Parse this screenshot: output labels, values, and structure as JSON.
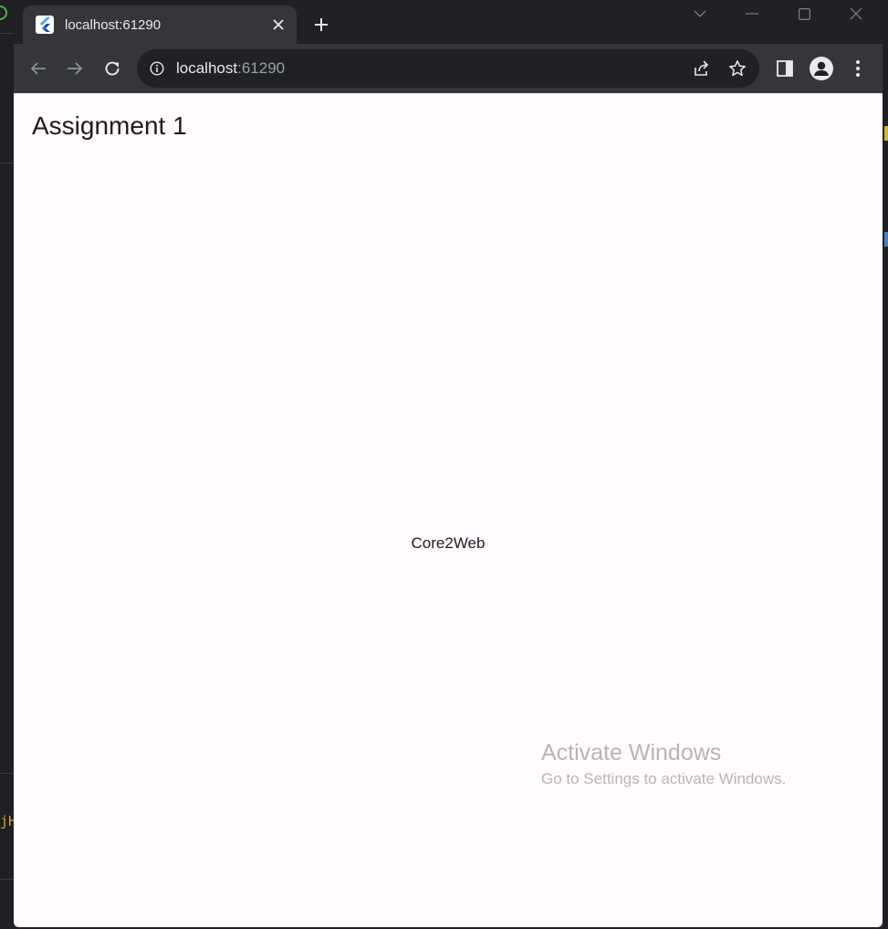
{
  "browser": {
    "tab": {
      "title": "localhost:61290",
      "favicon": "flutter-icon",
      "close_icon": "close-icon"
    },
    "new_tab_icon": "plus-icon",
    "window_controls": [
      "chevron-down-icon",
      "minimize-icon",
      "maximize-icon",
      "close-icon"
    ],
    "toolbar": {
      "back_icon": "arrow-left-icon",
      "forward_icon": "arrow-right-icon",
      "reload_icon": "reload-icon",
      "address": {
        "host": "localhost",
        "port": ":61290",
        "info_icon": "info-icon"
      },
      "share_icon": "share-icon",
      "bookmark_icon": "star-icon",
      "side_panel_icon": "side-panel-icon",
      "profile_icon": "avatar-icon",
      "menu_icon": "more-vert-icon"
    }
  },
  "app": {
    "title": "Assignment 1",
    "body_text": "Core2Web"
  },
  "watermark": {
    "line1": "Activate Windows",
    "line2": "Go to Settings to activate Windows."
  },
  "colors": {
    "tabstrip": "#202124",
    "toolbar": "#35363a",
    "page_background": "#fffbfe",
    "text": "#1d1b20"
  }
}
